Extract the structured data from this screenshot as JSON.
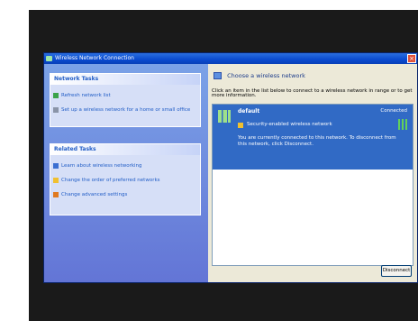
{
  "window": {
    "title": "Wireless Network Connection",
    "close_glyph": "×",
    "title_icon": "network-icon"
  },
  "sidebar": {
    "network_tasks": {
      "header": "Network Tasks",
      "items": [
        {
          "label": "Refresh network list",
          "icon": "refresh-icon"
        },
        {
          "label": "Set up a wireless network for a home or small office",
          "icon": "setup-icon"
        }
      ]
    },
    "related_tasks": {
      "header": "Related Tasks",
      "items": [
        {
          "label": "Learn about wireless networking",
          "icon": "info-icon"
        },
        {
          "label": "Change the order of preferred networks",
          "icon": "star-icon"
        },
        {
          "label": "Change advanced settings",
          "icon": "settings-icon"
        }
      ]
    }
  },
  "main": {
    "header": "Choose a wireless network",
    "instructions": "Click an item in the list below to connect to a wireless network in range or to get more information.",
    "networks": [
      {
        "name": "default",
        "status": "Connected",
        "security": "Security-enabled wireless network",
        "description": "You are currently connected to this network. To disconnect from this network, click Disconnect."
      }
    ],
    "action_button": "Disconnect"
  }
}
